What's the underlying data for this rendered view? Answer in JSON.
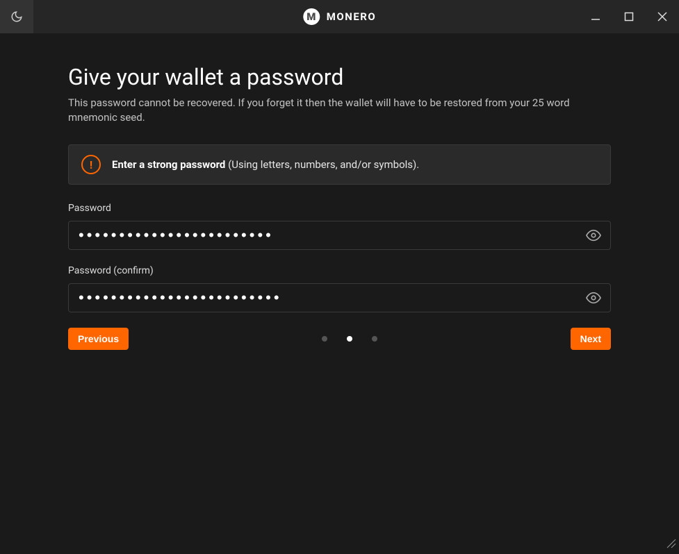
{
  "app": {
    "title": "MONERO"
  },
  "page": {
    "heading": "Give your wallet a password",
    "subheading": "This password cannot be recovered. If you forget it then the wallet will have to be restored from your 25 word mnemonic seed."
  },
  "warning": {
    "strong": "Enter a strong password",
    "rest": " (Using letters, numbers, and/or symbols)."
  },
  "fields": {
    "password_label": "Password",
    "password_value": "••••••••••••••••••••••••",
    "confirm_label": "Password (confirm)",
    "confirm_value": "•••••••••••••••••••••••••"
  },
  "nav": {
    "previous": "Previous",
    "next": "Next",
    "step_active": 2,
    "step_total": 3
  },
  "colors": {
    "accent": "#ff6600",
    "bg": "#1a1a1a"
  }
}
